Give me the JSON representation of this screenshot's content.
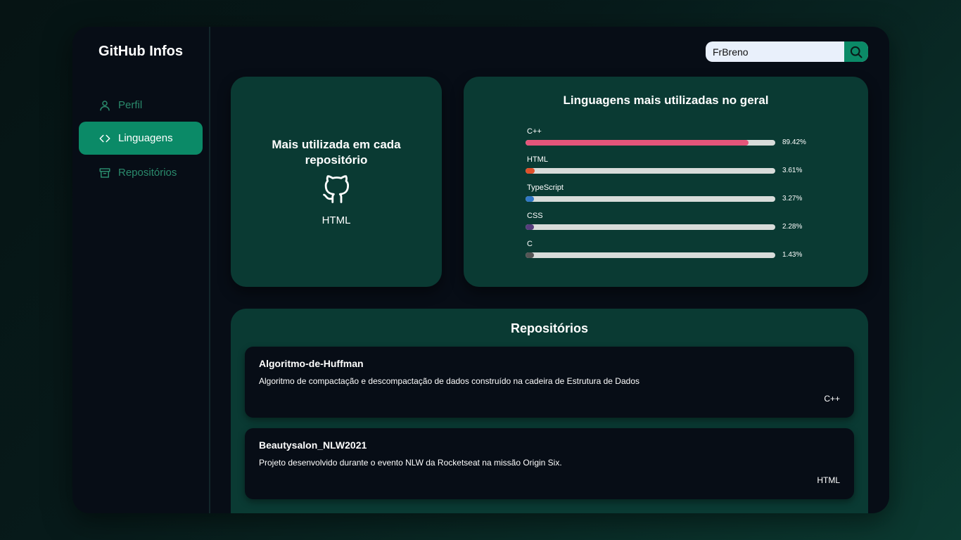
{
  "sidebar": {
    "brand": "GitHub Infos",
    "items": [
      {
        "label": "Perfil",
        "icon": "user-icon"
      },
      {
        "label": "Linguagens",
        "icon": "code-icon"
      },
      {
        "label": "Repositórios",
        "icon": "archive-icon"
      }
    ],
    "active": "Linguagens"
  },
  "search": {
    "value": "FrBreno",
    "icon": "search-icon"
  },
  "most_used": {
    "title": "Mais utilizada em cada repositório",
    "icon": "github-icon",
    "language": "HTML"
  },
  "languages": {
    "title": "Linguagens mais utilizadas no geral",
    "items": [
      {
        "name": "C++",
        "percent": 89.42,
        "label": "89.42%",
        "color": "#e4557a"
      },
      {
        "name": "HTML",
        "percent": 3.61,
        "label": "3.61%",
        "color": "#e0502a"
      },
      {
        "name": "TypeScript",
        "percent": 3.27,
        "label": "3.27%",
        "color": "#3178c6"
      },
      {
        "name": "CSS",
        "percent": 2.28,
        "label": "2.28%",
        "color": "#563d7c"
      },
      {
        "name": "C",
        "percent": 1.43,
        "label": "1.43%",
        "color": "#555555"
      }
    ]
  },
  "repositories": {
    "title": "Repositórios",
    "items": [
      {
        "name": "Algoritmo-de-Huffman",
        "description": "Algoritmo de compactação e descompactação de dados construído na cadeira de Estrutura de Dados",
        "language": "C++"
      },
      {
        "name": "Beautysalon_NLW2021",
        "description": "Projeto desenvolvido durante o evento NLW da Rocketseat na missão Origin Six.",
        "language": "HTML"
      }
    ]
  },
  "colors": {
    "accent": "#0b8a67",
    "card": "#0a3a33",
    "panel": "#070d16"
  }
}
